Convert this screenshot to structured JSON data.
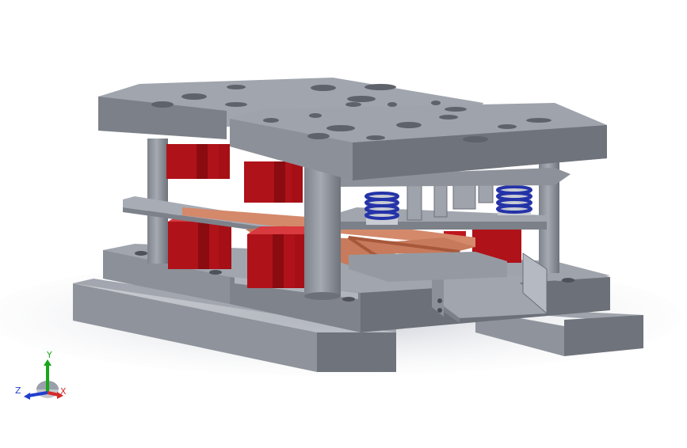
{
  "viewport": {
    "background": "#ffffff",
    "model": "stamping-die-assembly",
    "colors": {
      "steel": "#8f939b",
      "steel_dark": "#6c7078",
      "steel_top": "#9ea3ac",
      "guide_block": "#c8141b",
      "spring": "#2433a8",
      "strip": "#d4896b"
    }
  },
  "triad": {
    "x_label": "X",
    "y_label": "Y",
    "z_label": "Z",
    "x_color": "#d42a2a",
    "y_color": "#1aa61a",
    "z_color": "#1f3fcc"
  }
}
